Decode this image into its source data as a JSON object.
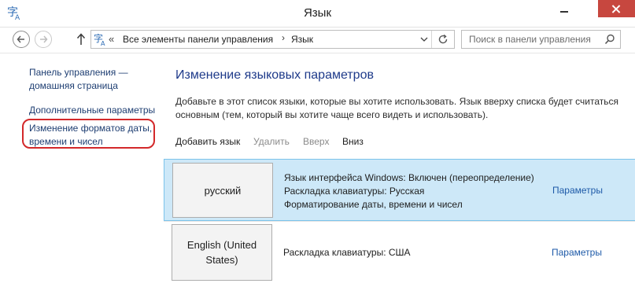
{
  "window": {
    "title": "Язык"
  },
  "address_bar": {
    "sep": "«",
    "crumbs": [
      "Все элементы панели управления",
      "Язык"
    ],
    "crumb_sep": "›"
  },
  "search": {
    "placeholder": "Поиск в панели управления"
  },
  "sidebar": {
    "home_link": "Панель управления —\nдомашняя страница",
    "links": [
      "Дополнительные параметры",
      "Изменение форматов даты,\nвремени и чисел"
    ]
  },
  "main": {
    "heading": "Изменение языковых параметров",
    "description": "Добавьте в этот список языки, которые вы хотите использовать. Язык вверху списка будет считаться основным (тем, который вы хотите чаще всего видеть и использовать).",
    "toolbar": {
      "add": "Добавить язык",
      "delete": "Удалить",
      "up": "Вверх",
      "down": "Вниз"
    },
    "languages": [
      {
        "name": "русский",
        "info": [
          "Язык интерфейса Windows: Включен (переопределение)",
          "Раскладка клавиатуры: Русская",
          "Форматирование даты, времени и чисел"
        ],
        "options": "Параметры",
        "selected": true
      },
      {
        "name": "English (United States)",
        "info": [
          "Раскладка клавиатуры: США"
        ],
        "options": "Параметры",
        "selected": false
      }
    ]
  },
  "colors": {
    "link": "#1e3e72",
    "heading": "#1e3a8a",
    "selection": "#cde8f8",
    "highlight_ring": "#d3282a",
    "close": "#c7473f"
  }
}
